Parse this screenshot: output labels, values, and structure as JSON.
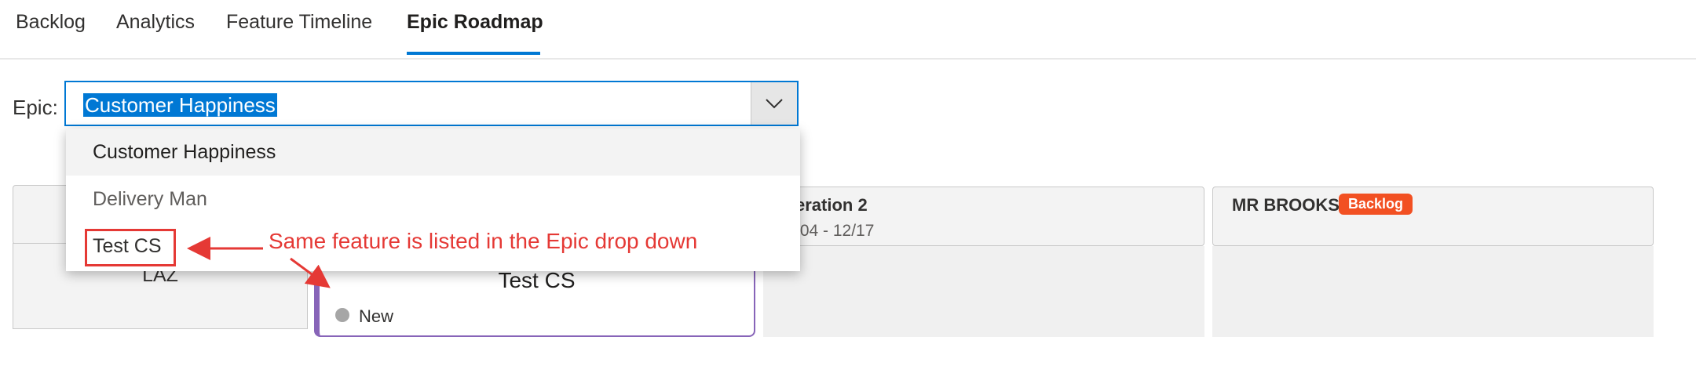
{
  "tabs": [
    {
      "label": "Backlog",
      "active": false
    },
    {
      "label": "Analytics",
      "active": false
    },
    {
      "label": "Feature Timeline",
      "active": false
    },
    {
      "label": "Epic Roadmap",
      "active": true
    }
  ],
  "epic_selector": {
    "label": "Epic:",
    "selected_value": "Customer Happiness",
    "options": [
      "Customer Happiness",
      "Delivery Man",
      "Test CS"
    ]
  },
  "board": {
    "columns": [
      {
        "title": "",
        "dates": "",
        "cards": [
          {
            "title": "LAZ"
          }
        ]
      },
      {
        "title": "",
        "dates": "",
        "cards": [
          {
            "title": "Test CS",
            "state": "New"
          }
        ]
      },
      {
        "title": "eration 2",
        "dates": "/04 - 12/17",
        "cards": []
      },
      {
        "title": "MR BROOKS",
        "badge": "Backlog",
        "cards": []
      }
    ]
  },
  "annotation": {
    "text": "Same feature is listed in  the Epic drop down",
    "color": "#e53935"
  },
  "colors": {
    "accent": "#0078d4",
    "feature_border": "#8764b8",
    "badge_backlog": "#f25022",
    "state_new": "#a6a6a6"
  },
  "icons": {
    "combo_toggle": "chevron-down-icon"
  }
}
